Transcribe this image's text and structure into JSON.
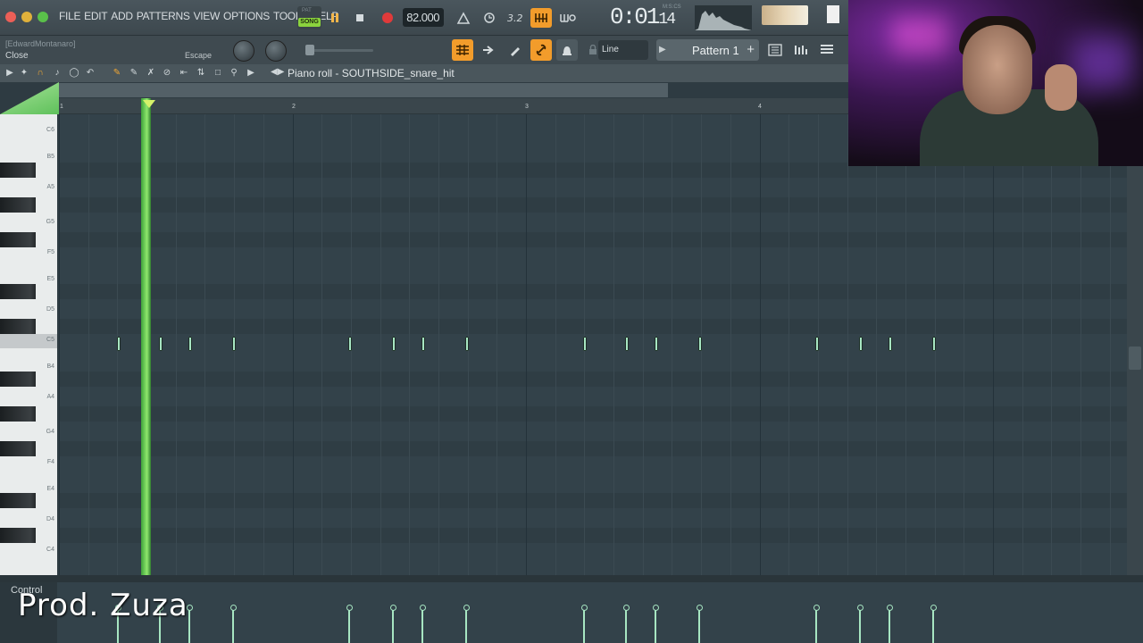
{
  "app": {
    "menu": [
      "FILE",
      "EDIT",
      "ADD",
      "PATTERNS",
      "VIEW",
      "OPTIONS",
      "TOOLS",
      "HELP"
    ],
    "song_toggle": {
      "pat_label": "PAT",
      "song_label": "SONG"
    },
    "tempo": "82.000",
    "time": {
      "main": "0:01",
      "sub": "14",
      "format_label": "M:S:CS"
    },
    "user_hint": "[EdwardMontanaro]",
    "hint_action": "Close",
    "escape_label": "Escape",
    "snap_mode": "Line",
    "pattern": "Pattern 1"
  },
  "piano_roll": {
    "title": "Piano roll - SOUTHSIDE_snare_hit",
    "bar_numbers": [
      "1",
      "2",
      "3",
      "4"
    ],
    "key_labels": [
      "C6",
      "B5",
      "A5",
      "G5",
      "F5",
      "E5",
      "D5",
      "C5",
      "B4",
      "A4",
      "G4",
      "F4",
      "E4",
      "D4",
      "C4"
    ],
    "note_pitch": "C5",
    "note_count": 16
  },
  "control": {
    "label": "Control"
  },
  "overlay": {
    "watermark": "Prod. Zuza"
  },
  "colors": {
    "accent": "#f29c2b",
    "note": "#a7e6c2",
    "playhead": "#8fe86d",
    "song": "#8bd33d",
    "record": "#e03a3a"
  }
}
